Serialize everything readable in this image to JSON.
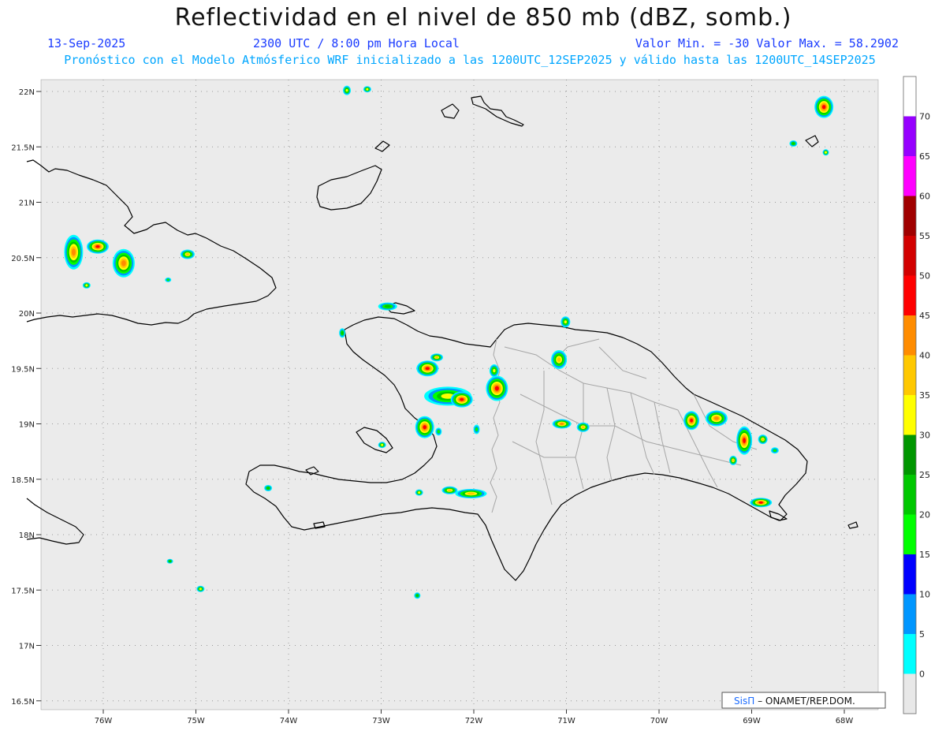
{
  "header": {
    "title": "Reflectividad en el nivel de 850 mb (dBZ, somb.)",
    "date": "13-Sep-2025",
    "time": "2300 UTC / 8:00 pm Hora Local",
    "minmax": "Valor Min. = -30  Valor Max. = 58.2902",
    "forecast_note": "Pronóstico con el Modelo Atmósferico WRF inicializado a las 1200UTC_12SEP2025 y válido hasta las  1200UTC_14SEP2025"
  },
  "axes": {
    "lat_ticks": [
      "22N",
      "21.5N",
      "21N",
      "20.5N",
      "20N",
      "19.5N",
      "19N",
      "18.5N",
      "18N",
      "17.5N",
      "17N",
      "16.5N"
    ],
    "lon_ticks": [
      "76W",
      "75W",
      "74W",
      "73W",
      "72W",
      "71W",
      "70W",
      "69W",
      "68W"
    ],
    "lat_values": [
      22,
      21.5,
      21,
      20.5,
      20,
      19.5,
      19,
      18.5,
      18,
      17.5,
      17,
      16.5
    ],
    "lon_values": [
      -76,
      -75,
      -74,
      -73,
      -72,
      -71,
      -70,
      -69,
      -68
    ]
  },
  "legend": {
    "labels": [
      "0",
      "5",
      "10",
      "15",
      "20",
      "25",
      "30",
      "35",
      "40",
      "45",
      "50",
      "55",
      "60",
      "65",
      "70"
    ],
    "colors": [
      "#e8e8e8",
      "#00ffff",
      "#0096ff",
      "#0000ff",
      "#00ff00",
      "#00c800",
      "#009600",
      "#ffff00",
      "#ffc800",
      "#ff8c00",
      "#ff0000",
      "#d20000",
      "#a00000",
      "#ff00ff",
      "#9600ff",
      "#ffffff"
    ]
  },
  "credit": {
    "accent": "SisΠ",
    "text": "– ONAMET/REP.DOM."
  }
}
